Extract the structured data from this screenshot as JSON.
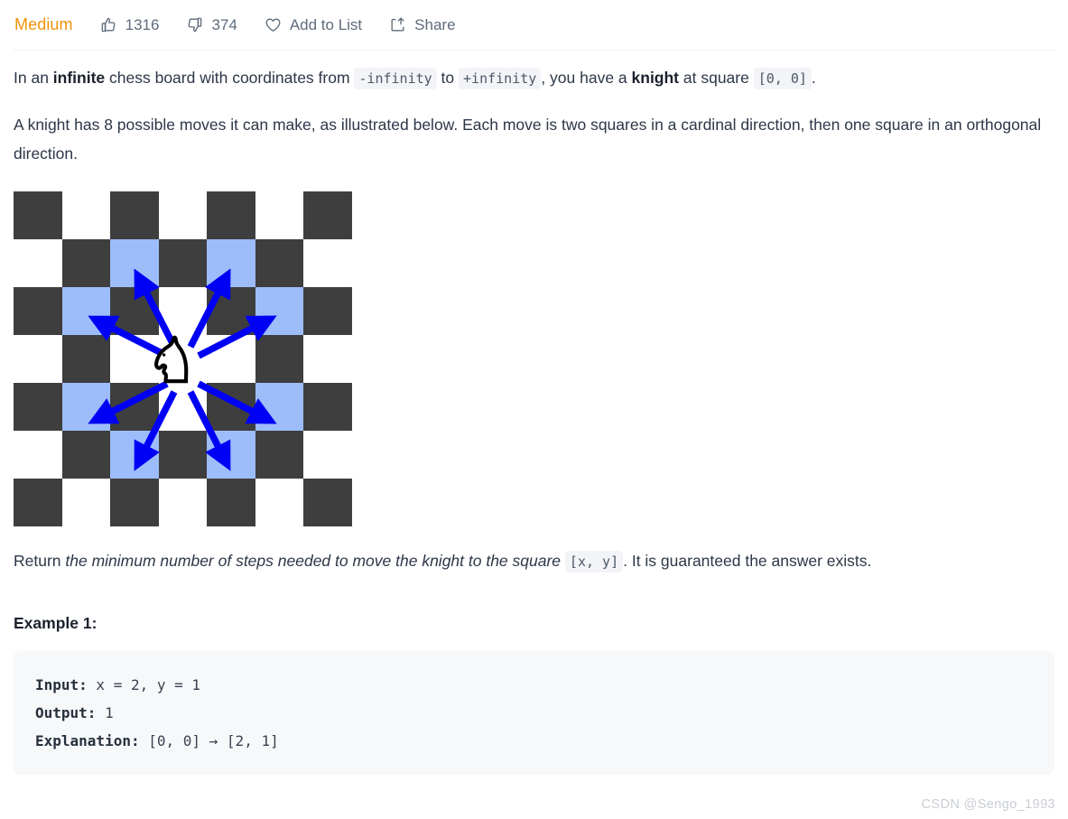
{
  "toolbar": {
    "difficulty": "Medium",
    "like": {
      "icon": "thumbs-up-icon",
      "count": "1316"
    },
    "dislike": {
      "icon": "thumbs-down-icon",
      "count": "374"
    },
    "add_to_list": {
      "icon": "heart-icon",
      "label": "Add to List"
    },
    "share": {
      "icon": "share-icon",
      "label": "Share"
    },
    "accent_color": "#f0920a"
  },
  "description": {
    "p1": {
      "t1": "In an ",
      "b1": "infinite",
      "t2": " chess board with coordinates from ",
      "c1": "-infinity",
      "t3": " to ",
      "c2": "+infinity",
      "t4": ", you have a ",
      "b2": "knight",
      "t5": " at square ",
      "c3": "[0, 0]",
      "t6": "."
    },
    "p2": "A knight has 8 possible moves it can make, as illustrated below. Each move is two squares in a cardinal direction, then one square in an orthogonal direction.",
    "p3": {
      "t1": "Return ",
      "i1": "the minimum number of steps needed to move the knight to the square",
      "t2": " ",
      "c1": "[x, y]",
      "t3": ". It is guaranteed the answer exists."
    }
  },
  "board": {
    "rows": 7,
    "cols": 7,
    "colors": {
      "dark": "#3e3e3e",
      "light": "#ffffff",
      "highlight": "#9dbcfa",
      "arrow": "#0000f5"
    },
    "cells": [
      [
        "dark",
        "light",
        "dark",
        "light",
        "dark",
        "light",
        "dark"
      ],
      [
        "light",
        "dark",
        "hl",
        "dark",
        "hl",
        "dark",
        "light"
      ],
      [
        "dark",
        "hl",
        "dark",
        "light",
        "dark",
        "hl",
        "dark"
      ],
      [
        "light",
        "dark",
        "light",
        "knight",
        "light",
        "dark",
        "light"
      ],
      [
        "dark",
        "hl",
        "dark",
        "light",
        "dark",
        "hl",
        "dark"
      ],
      [
        "light",
        "dark",
        "hl",
        "dark",
        "hl",
        "dark",
        "light"
      ],
      [
        "dark",
        "light",
        "dark",
        "light",
        "dark",
        "light",
        "dark"
      ]
    ],
    "knight_square": "[0, 0]",
    "move_count": 8
  },
  "example": {
    "heading": "Example 1:",
    "input_label": "Input:",
    "input_value": " x = 2, y = 1",
    "output_label": "Output:",
    "output_value": " 1",
    "explanation_label": "Explanation:",
    "explanation_value": " [0, 0] → [2, 1]"
  },
  "watermark": "CSDN @Sengo_1993"
}
